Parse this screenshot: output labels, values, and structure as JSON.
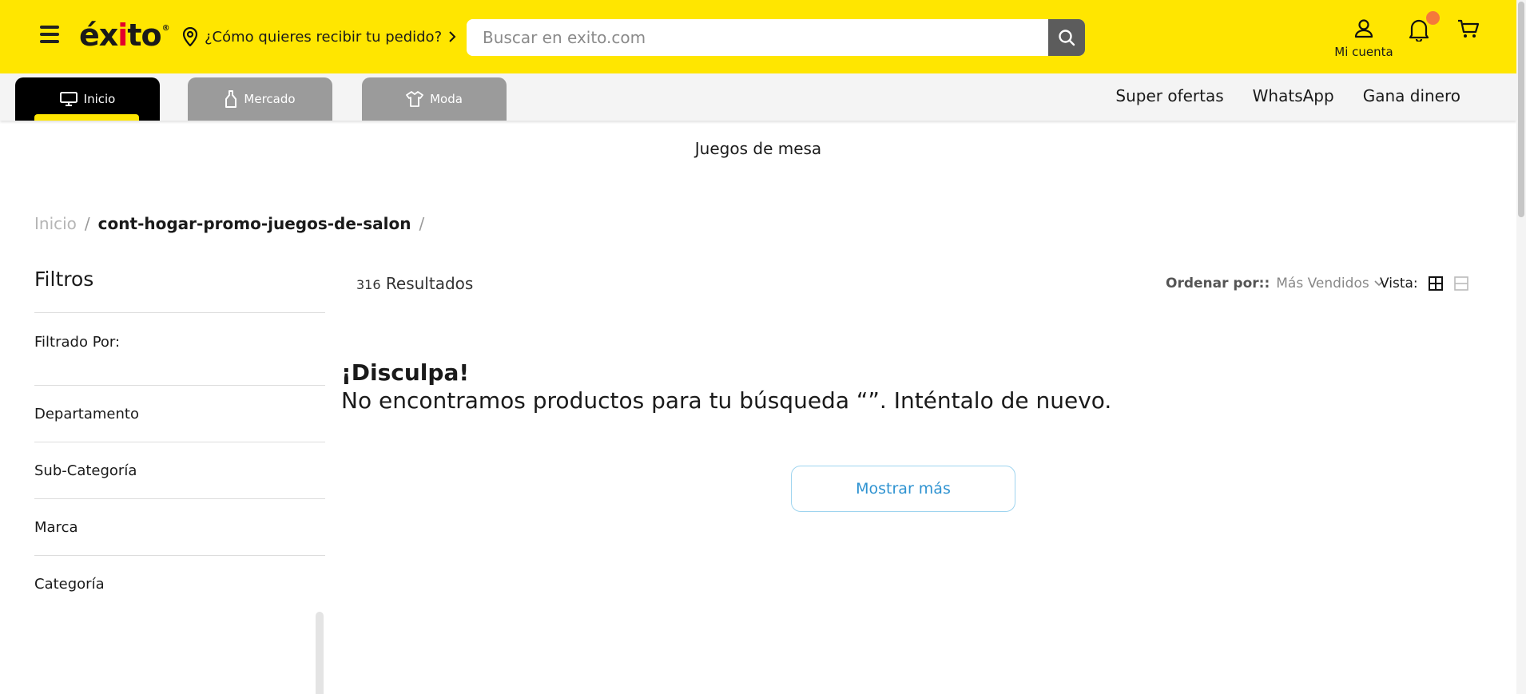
{
  "header": {
    "logo_text": "éxito",
    "logo_mark": "®",
    "delivery_prompt": "¿Cómo quieres recibir tu pedido?",
    "search_placeholder": "Buscar en exito.com",
    "account_label": "Mi cuenta",
    "icons": [
      "menu-icon",
      "location-pin-icon",
      "chevron-right-icon",
      "search-icon",
      "user-icon",
      "bell-icon",
      "cart-icon"
    ],
    "colors": {
      "brand_yellow": "#ffe600",
      "badge_orange": "#f5793a",
      "search_button": "#5c5c5c"
    }
  },
  "nav": {
    "tabs": [
      {
        "label": "Inicio",
        "icon": "monitor-icon",
        "active": true
      },
      {
        "label": "Mercado",
        "icon": "bottle-icon",
        "active": false
      },
      {
        "label": "Moda",
        "icon": "shirt-icon",
        "active": false
      }
    ],
    "links": [
      "Super ofertas",
      "WhatsApp",
      "Gana dinero"
    ]
  },
  "page_title": "Juegos de mesa",
  "breadcrumb": {
    "home": "Inicio",
    "separator": "/",
    "current": "cont-hogar-promo-juegos-de-salon",
    "trailing": "/"
  },
  "filters": {
    "title": "Filtros",
    "filtered_by": "Filtrado Por:",
    "facets": [
      "Departamento",
      "Sub-Categoría",
      "Marca",
      "Categoría"
    ]
  },
  "results": {
    "count": "316",
    "count_label": "Resultados",
    "sort_label": "Ordenar por::",
    "sort_value": "Más Vendidos",
    "view_label": "Vista:"
  },
  "empty_state": {
    "title": "¡Disculpa!",
    "message": "No encontramos productos para tu búsqueda  “”. Inténtalo de nuevo."
  },
  "show_more_label": "Mostrar más",
  "colors": {
    "link_blue": "#2f93d1",
    "button_border": "#9ed4ef"
  }
}
